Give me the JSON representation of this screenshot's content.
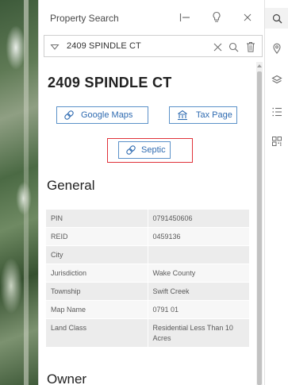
{
  "panel": {
    "title": "Property Search",
    "search_value": "2409 SPINDLE CT"
  },
  "property": {
    "address": "2409 SPINDLE CT",
    "buttons": {
      "google_maps": "Google Maps",
      "tax_page": "Tax Page",
      "septic": "Septic"
    }
  },
  "general": {
    "heading": "General",
    "rows": [
      {
        "label": "PIN",
        "value": "0791450606"
      },
      {
        "label": "REID",
        "value": "0459136"
      },
      {
        "label": "City",
        "value": ""
      },
      {
        "label": "Jurisdiction",
        "value": "Wake County"
      },
      {
        "label": "Township",
        "value": "Swift Creek"
      },
      {
        "label": "Map Name",
        "value": "0791 01"
      },
      {
        "label": "Land Class",
        "value": "Residential Less Than 10 Acres"
      }
    ]
  },
  "owner": {
    "heading": "Owner"
  },
  "colors": {
    "accent": "#2f6bb1",
    "highlight": "#e0323a"
  },
  "icons": {
    "dock": "dock-icon",
    "lightbulb": "lightbulb-icon",
    "close": "close-icon",
    "caret": "caret-down-icon",
    "clear": "clear-icon",
    "search": "search-icon",
    "trash": "trash-icon",
    "link": "link-icon",
    "tax": "building-icon",
    "toolbar": [
      "search-icon",
      "pin-icon",
      "layers-icon",
      "list-icon",
      "qr-icon"
    ]
  }
}
